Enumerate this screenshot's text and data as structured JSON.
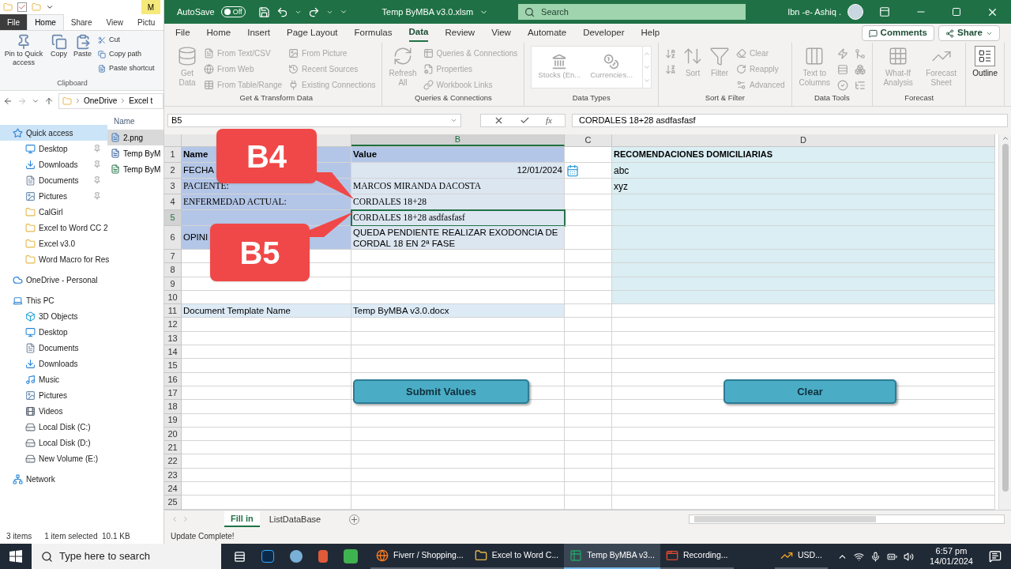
{
  "explorer": {
    "context_tab": "M",
    "tabs": [
      {
        "label": "File",
        "selected": false
      },
      {
        "label": "Home",
        "selected": true
      },
      {
        "label": "Share",
        "selected": false
      },
      {
        "label": "View",
        "selected": false
      },
      {
        "label": "Pictu",
        "selected": false
      }
    ],
    "large_buttons": [
      "Pin to Quick access",
      "Copy",
      "Paste"
    ],
    "small_buttons": [
      "Cut",
      "Copy path",
      "Paste shortcut"
    ],
    "group": "Clipboard",
    "breadcrumb": [
      "OneDrive",
      "Excel t"
    ],
    "nav": [
      {
        "label": "Quick access",
        "kind": "star",
        "selected": true,
        "children": [
          {
            "label": "Desktop",
            "kind": "desktop",
            "pinned": true
          },
          {
            "label": "Downloads",
            "kind": "download",
            "pinned": true
          },
          {
            "label": "Documents",
            "kind": "document",
            "pinned": true
          },
          {
            "label": "Pictures",
            "kind": "picture",
            "pinned": true
          },
          {
            "label": "CalGirl",
            "kind": "folder",
            "pinned": false
          },
          {
            "label": "Excel to Word CC 2",
            "kind": "folder",
            "pinned": false
          },
          {
            "label": "Excel v3.0",
            "kind": "folder",
            "pinned": false
          },
          {
            "label": "Word Macro for Res",
            "kind": "folder",
            "pinned": false
          }
        ]
      },
      {
        "label": "OneDrive - Personal",
        "kind": "cloud",
        "selected": false
      },
      {
        "label": "This PC",
        "kind": "pc",
        "selected": false,
        "children": [
          {
            "label": "3D Objects",
            "kind": "cube"
          },
          {
            "label": "Desktop",
            "kind": "desktop"
          },
          {
            "label": "Documents",
            "kind": "document"
          },
          {
            "label": "Downloads",
            "kind": "download"
          },
          {
            "label": "Music",
            "kind": "music"
          },
          {
            "label": "Pictures",
            "kind": "picture"
          },
          {
            "label": "Videos",
            "kind": "video"
          },
          {
            "label": "Local Disk (C:)",
            "kind": "disk"
          },
          {
            "label": "Local Disk (D:)",
            "kind": "disk"
          },
          {
            "label": "New Volume (E:)",
            "kind": "disk"
          }
        ]
      },
      {
        "label": "Network",
        "kind": "network",
        "selected": false
      }
    ],
    "column_header": "Name",
    "files": [
      {
        "name": "2.png",
        "kind": "image",
        "selected": true
      },
      {
        "name": "Temp ByM",
        "kind": "word",
        "selected": false
      },
      {
        "name": "Temp ByM",
        "kind": "excel",
        "selected": false
      }
    ],
    "status": [
      "3 items",
      "1 item selected  10.1 KB"
    ]
  },
  "excel": {
    "autosave": {
      "label": "AutoSave",
      "toggle": "Off",
      "on": false
    },
    "title": "Temp ByMBA v3.0.xlsm",
    "search": {
      "placeholder": "Search"
    },
    "user": "Ibn -e- Ashiq .",
    "menu": [
      {
        "label": "File",
        "selected": false
      },
      {
        "label": "Home",
        "selected": false
      },
      {
        "label": "Insert",
        "selected": false
      },
      {
        "label": "Page Layout",
        "selected": false
      },
      {
        "label": "Formulas",
        "selected": false
      },
      {
        "label": "Data",
        "selected": true
      },
      {
        "label": "Review",
        "selected": false
      },
      {
        "label": "View",
        "selected": false
      },
      {
        "label": "Automate",
        "selected": false
      },
      {
        "label": "Developer",
        "selected": false
      },
      {
        "label": "Help",
        "selected": false
      }
    ],
    "comments": "Comments",
    "share": "Share",
    "ribbon": [
      {
        "label": "Get & Transform Data",
        "items": [
          {
            "label": "Get Data",
            "kind": "large",
            "disabled": true
          },
          {
            "label": "From Text/CSV",
            "kind": "small",
            "disabled": true
          },
          {
            "label": "From Web",
            "kind": "small",
            "disabled": true
          },
          {
            "label": "From Table/Range",
            "kind": "small",
            "disabled": true
          },
          {
            "label": "From Picture",
            "kind": "small",
            "disabled": true
          },
          {
            "label": "Recent Sources",
            "kind": "small",
            "disabled": true
          },
          {
            "label": "Existing Connections",
            "kind": "small",
            "disabled": true
          }
        ]
      },
      {
        "label": "Queries & Connections",
        "items": [
          {
            "label": "Refresh All",
            "kind": "large",
            "disabled": true
          },
          {
            "label": "Queries & Connections",
            "kind": "small",
            "disabled": true
          },
          {
            "label": "Properties",
            "kind": "small",
            "disabled": true
          },
          {
            "label": "Workbook Links",
            "kind": "small",
            "disabled": true
          }
        ]
      },
      {
        "label": "Data Types",
        "items": [
          {
            "label": "Stocks (En...",
            "kind": "gallery",
            "disabled": true
          },
          {
            "label": "Currencies...",
            "kind": "gallery",
            "disabled": true
          }
        ]
      },
      {
        "label": "Sort & Filter",
        "items": [
          {
            "kind": "icon",
            "disabled": true
          },
          {
            "kind": "icon",
            "disabled": true
          },
          {
            "label": "Sort",
            "kind": "large",
            "disabled": true
          },
          {
            "label": "Filter",
            "kind": "large",
            "disabled": true
          },
          {
            "label": "Clear",
            "kind": "small",
            "disabled": true
          },
          {
            "label": "Reapply",
            "kind": "small",
            "disabled": true
          },
          {
            "label": "Advanced",
            "kind": "small",
            "disabled": true
          }
        ]
      },
      {
        "label": "Data Tools",
        "items": [
          {
            "label": "Text to Columns",
            "kind": "large",
            "disabled": true
          },
          {
            "kind": "icon",
            "disabled": true
          },
          {
            "kind": "icon",
            "disabled": true
          },
          {
            "kind": "icon",
            "disabled": true
          },
          {
            "kind": "icon",
            "disabled": true
          },
          {
            "kind": "icon",
            "disabled": true
          },
          {
            "kind": "icon",
            "disabled": true
          }
        ]
      },
      {
        "label": "Forecast",
        "items": [
          {
            "label": "What-If Analysis",
            "kind": "large",
            "disabled": true
          },
          {
            "label": "Forecast Sheet",
            "kind": "large",
            "disabled": true
          }
        ]
      },
      {
        "items": [
          {
            "label": "Outline",
            "kind": "large",
            "disabled": false
          }
        ]
      }
    ],
    "name_box": "B5",
    "function_label": "fx",
    "formula": "CORDALES 18+28 asdfasfasf",
    "columns": [
      {
        "label": "B",
        "selected": true
      },
      {
        "label": "C",
        "selected": false
      },
      {
        "label": "D",
        "selected": false
      }
    ],
    "rows": [
      {
        "n": "1",
        "kind": "header",
        "selected": false,
        "serif": false,
        "a": "Name",
        "b": "Value",
        "d": "RECOMENDACIONES DOMICILIARIAS"
      },
      {
        "n": "2",
        "kind": "form",
        "selected": false,
        "serif": false,
        "a": "FECHA",
        "b": "12/01/2024",
        "date_picker": true,
        "d": "abc"
      },
      {
        "n": "3",
        "kind": "form",
        "selected": false,
        "serif": true,
        "a": "PACIENTE:",
        "b": "MARCOS MIRANDA DACOSTA",
        "d": "xyz"
      },
      {
        "n": "4",
        "kind": "form",
        "selected": false,
        "serif": true,
        "a": "ENFERMEDAD ACTUAL:",
        "b": "CORDALES 18+28"
      },
      {
        "n": "5",
        "kind": "form",
        "selected": true,
        "serif": true,
        "b": "CORDALES 18+28 asdfasfasf"
      },
      {
        "n": "6",
        "kind": "form_tall",
        "selected": false,
        "serif": false,
        "a": "OPINI",
        "b": "QUEDA PENDIENTE REALIZAR EXODONCIA DE CORDAL 18 EN 2ª FASE"
      },
      {
        "n": "7",
        "kind": "blank_form",
        "selected": false
      },
      {
        "n": "8",
        "kind": "blank_form",
        "selected": false
      },
      {
        "n": "9",
        "kind": "blank_form",
        "selected": false
      },
      {
        "n": "10",
        "kind": "blank_form",
        "selected": false
      },
      {
        "n": "11",
        "kind": "footer",
        "selected": false,
        "serif": false,
        "a": "Document Template Name",
        "b": "Temp ByMBA v3.0.docx"
      },
      {
        "n": "12",
        "kind": "empty",
        "selected": false
      },
      {
        "n": "13",
        "kind": "empty",
        "selected": false
      },
      {
        "n": "14",
        "kind": "empty",
        "selected": false
      },
      {
        "n": "15",
        "kind": "empty",
        "selected": false
      },
      {
        "n": "16",
        "kind": "empty",
        "selected": false
      },
      {
        "n": "17",
        "kind": "empty",
        "selected": false
      },
      {
        "n": "18",
        "kind": "empty",
        "selected": false
      },
      {
        "n": "19",
        "kind": "empty",
        "selected": false
      },
      {
        "n": "20",
        "kind": "empty",
        "selected": false
      },
      {
        "n": "21",
        "kind": "empty",
        "selected": false
      },
      {
        "n": "22",
        "kind": "empty",
        "selected": false
      },
      {
        "n": "23",
        "kind": "empty",
        "selected": false
      },
      {
        "n": "24",
        "kind": "empty",
        "selected": false
      },
      {
        "n": "25",
        "kind": "empty",
        "selected": false
      }
    ],
    "callouts": [
      "B4",
      "B5"
    ],
    "sheet_buttons": [
      "Submit Values",
      "Clear"
    ],
    "sheets": [
      {
        "label": "Fill in",
        "selected": true
      },
      {
        "label": "ListDataBase",
        "selected": false
      }
    ],
    "status": "Update Complete!"
  },
  "taskbar": {
    "search": {
      "placeholder": "Type here to search"
    },
    "apps": [
      {
        "label": "Fiverr / Shopping...",
        "kind": "browser",
        "active": false
      },
      {
        "label": "Excel to Word C...",
        "kind": "folder",
        "active": false
      },
      {
        "label": "Temp ByMBA v3...",
        "kind": "excel",
        "active": true
      },
      {
        "label": "Recording...",
        "kind": "recorder",
        "active": false
      },
      {
        "label": "USD...",
        "kind": "stocks",
        "active": false
      }
    ],
    "time": "6:57 pm",
    "date": "14/01/2024"
  }
}
